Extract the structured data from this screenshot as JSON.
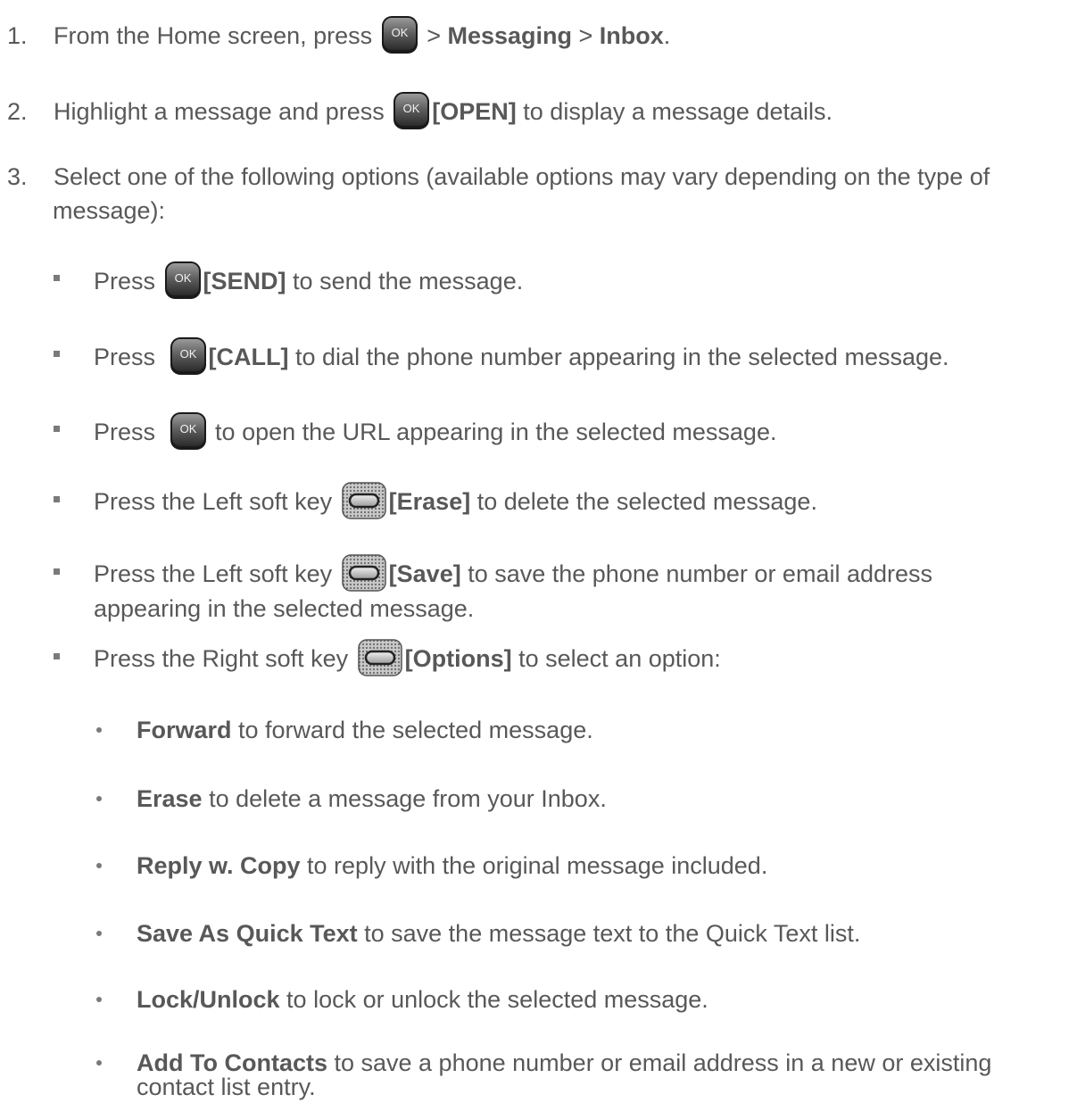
{
  "steps": [
    {
      "num": "1.",
      "pre": "From the Home screen, press",
      "after": " > ",
      "b1": "Messaging",
      "mid": " > ",
      "b2": "Inbox",
      "end": "."
    },
    {
      "num": "2.",
      "pre": "Highlight a message and press",
      "bold": "[OPEN]",
      "post": " to display a message details."
    },
    {
      "num": "3.",
      "line1": "Select one of the following options (available options may vary depending on the type of",
      "line2": "message):"
    }
  ],
  "bullets": [
    {
      "pre": "Press",
      "bold": "[SEND]",
      "post": " to send the message."
    },
    {
      "pre": "Press",
      "bold": "[CALL]",
      "post": " to dial the phone number appearing in the selected message."
    },
    {
      "pre": "Press",
      "post": " to open the URL appearing in the selected message."
    },
    {
      "pre": "Press the Left soft key",
      "bold": "[Erase]",
      "post": " to delete the selected message."
    },
    {
      "pre": "Press the Left soft key",
      "bold": "[Save]",
      "post": " to save the phone number or email address",
      "line2": "appearing in the selected message."
    },
    {
      "pre": "Press the Right soft key",
      "bold": "[Options]",
      "post": " to select an option:"
    }
  ],
  "options": [
    {
      "bold": "Forward",
      "post": " to forward the selected message."
    },
    {
      "bold": "Erase",
      "post": " to delete a message from your Inbox."
    },
    {
      "bold": "Reply w. Copy",
      "post": " to reply with the original message included."
    },
    {
      "bold": "Save As Quick Text",
      "post": " to save the message text to the Quick Text list."
    },
    {
      "bold": "Lock/Unlock",
      "post": " to lock or unlock the selected message."
    },
    {
      "bold": "Add To Contacts",
      "post": " to save a phone number or email address in a new or existing",
      "line2": "contact list entry."
    }
  ],
  "icons": {
    "ok_label": "OK",
    "ok_icon": "ok-key-icon",
    "soft_icon": "soft-key-icon"
  }
}
